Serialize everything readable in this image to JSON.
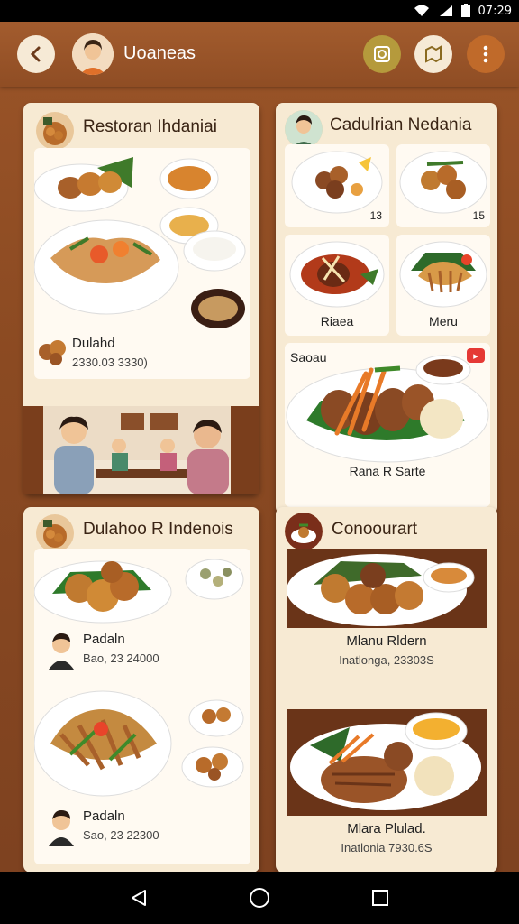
{
  "status": {
    "time": "07:29"
  },
  "header": {
    "title": "Uoaneas"
  },
  "cards": {
    "c1": {
      "title": "Restoran Ihdaniai",
      "item_name": "Dulahd",
      "item_price": "2330.03 3330)"
    },
    "c2": {
      "title": "Cadulrian Nedania",
      "num_a": "13",
      "num_b": "15",
      "lbl_a": "Riaea",
      "lbl_b": "Meru",
      "feature_label": "Saoau",
      "feature_caption": "Rana R Sarte"
    },
    "c3": {
      "title": "Dulahoo R Indenois",
      "item1_name": "Padaln",
      "item1_price": "Bao, 23 24000",
      "item2_name": "Padaln",
      "item2_price": "Sao, 23 22300"
    },
    "c4": {
      "title": "Conoourart",
      "item1_name": "Mlanu Rldern",
      "item1_sub": "Inatlonga, 23303S",
      "item2_name": "Mlara Plulad.",
      "item2_sub": "Inatlonia 7930.6S"
    }
  },
  "colors": {
    "accent": "#8b4a22",
    "card": "#f7ead3",
    "badge": "#e53935"
  }
}
